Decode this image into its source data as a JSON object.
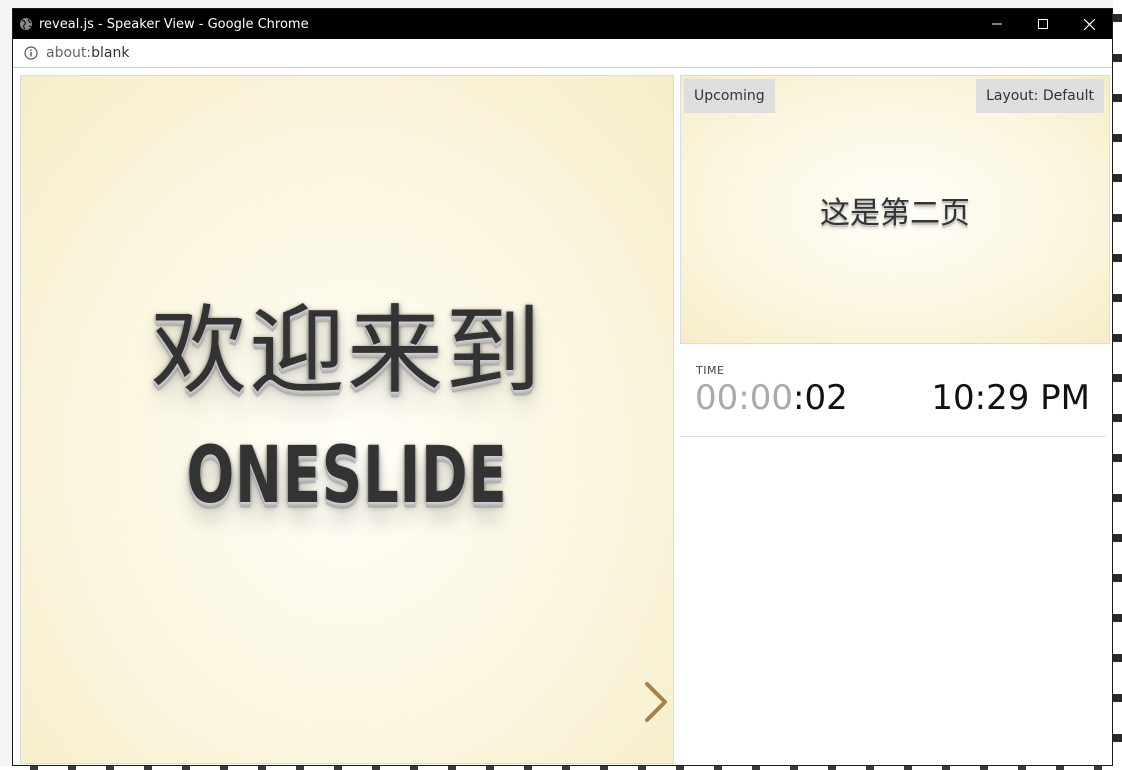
{
  "window": {
    "title": "reveal.js - Speaker View - Google Chrome",
    "controls": {
      "minimize": "minimize",
      "maximize": "maximize",
      "close": "close"
    }
  },
  "address": {
    "scheme": "about:",
    "path": "blank"
  },
  "current_slide": {
    "heading": "欢迎来到",
    "subheading": "ONESLIDE"
  },
  "upcoming": {
    "label": "Upcoming",
    "layout_button": "Layout: Default",
    "slide_text": "这是第二页"
  },
  "time": {
    "label": "TIME",
    "hours": "00",
    "minutes": "00",
    "seconds": "02",
    "clock": "10:29 PM"
  },
  "colors": {
    "titlebar": "#000000",
    "slide_bg": "#fbf6df",
    "arrow": "#a3824c",
    "text": "#333333"
  }
}
